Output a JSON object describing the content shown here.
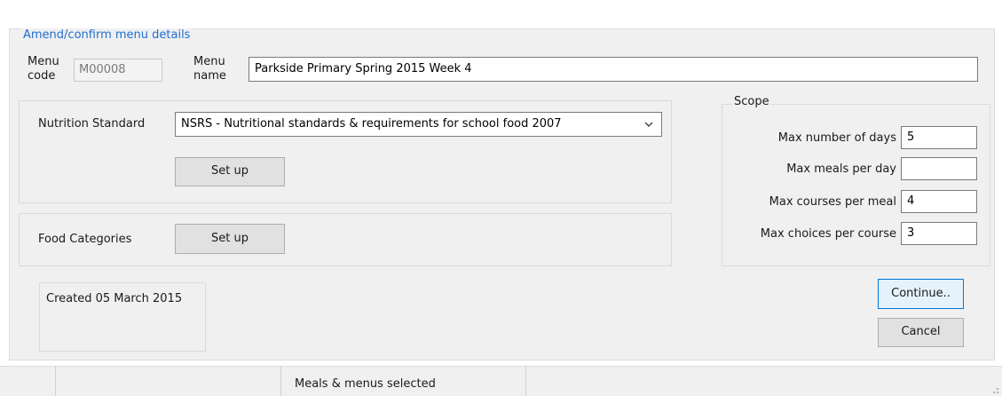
{
  "dialog": {
    "title": "Amend/confirm menu details",
    "menu_code_label_line1": "Menu",
    "menu_code_label_line2": "code",
    "menu_code_value": "M00008",
    "menu_name_label_line1": "Menu",
    "menu_name_label_line2": "name",
    "menu_name_value": "Parkside Primary Spring 2015 Week 4"
  },
  "nutrition": {
    "label": "Nutrition Standard",
    "selected": "NSRS - Nutritional standards & requirements for school food 2007",
    "setup_label": "Set up"
  },
  "food_categories": {
    "label": "Food Categories",
    "setup_label": "Set up"
  },
  "scope": {
    "title": "Scope",
    "fields": [
      {
        "label": "Max number of days",
        "value": "5"
      },
      {
        "label": "Max meals per day",
        "value": ""
      },
      {
        "label": "Max courses per meal",
        "value": "4"
      },
      {
        "label": "Max choices per course",
        "value": "3"
      }
    ]
  },
  "created_text": "Created 05 March 2015",
  "buttons": {
    "continue": "Continue..",
    "cancel": "Cancel"
  },
  "statusbar": {
    "text": "Meals & menus selected"
  },
  "colors": {
    "accent": "#1f6fd0",
    "primary_border": "#0078d7"
  }
}
